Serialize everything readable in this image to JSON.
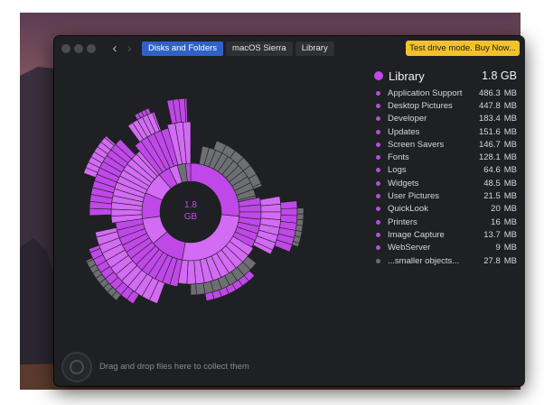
{
  "window": {
    "breadcrumbs": [
      "Disks and Folders",
      "macOS Sierra",
      "Library"
    ],
    "trial_button": "Test drive mode. Buy Now...",
    "back_icon": "chevron-left-icon",
    "forward_icon": "chevron-right-icon"
  },
  "chart": {
    "center_size": "1.8",
    "center_unit": "GB"
  },
  "panel": {
    "folder_name": "Library",
    "folder_size": "1.8 GB",
    "items": [
      {
        "name": "Application Support",
        "size": "486.3",
        "unit": "MB"
      },
      {
        "name": "Desktop Pictures",
        "size": "447.8",
        "unit": "MB"
      },
      {
        "name": "Developer",
        "size": "183.4",
        "unit": "MB"
      },
      {
        "name": "Updates",
        "size": "151.6",
        "unit": "MB"
      },
      {
        "name": "Screen Savers",
        "size": "146.7",
        "unit": "MB"
      },
      {
        "name": "Fonts",
        "size": "128.1",
        "unit": "MB"
      },
      {
        "name": "Logs",
        "size": "64.6",
        "unit": "MB"
      },
      {
        "name": "Widgets",
        "size": "48.5",
        "unit": "MB"
      },
      {
        "name": "User Pictures",
        "size": "21.5",
        "unit": "MB"
      },
      {
        "name": "QuickLook",
        "size": "20",
        "unit": "MB"
      },
      {
        "name": "Printers",
        "size": "16",
        "unit": "MB"
      },
      {
        "name": "Image Capture",
        "size": "13.7",
        "unit": "MB"
      },
      {
        "name": "WebServer",
        "size": "9",
        "unit": "MB"
      },
      {
        "name": "...smaller objects...",
        "size": "27.8",
        "unit": "MB"
      }
    ]
  },
  "dropzone": {
    "text": "Drag and drop files here to collect them"
  },
  "colors": {
    "accent": "#c048e8",
    "accent_light": "#d36bf4",
    "grey_segment": "#6e6f73",
    "breadcrumb_active": "#2f62c7",
    "trial_yellow": "#f2c22b"
  }
}
